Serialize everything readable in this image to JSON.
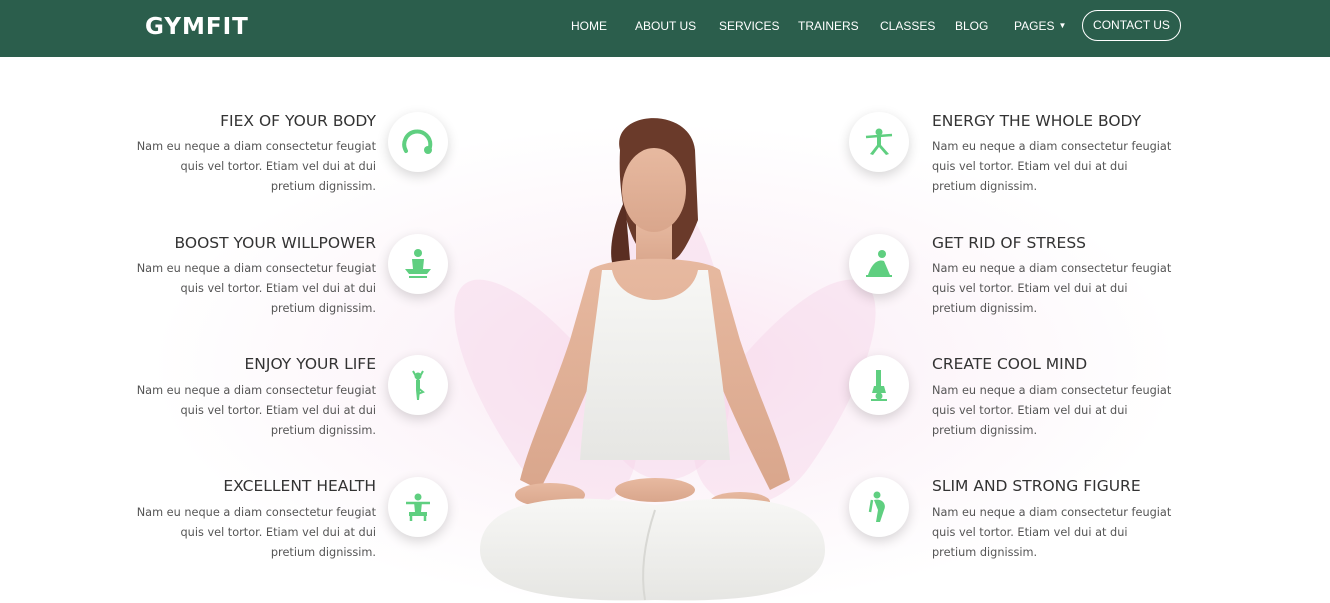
{
  "brand": {
    "logo": "GYMFIT"
  },
  "nav": {
    "items": [
      {
        "label": "HOME"
      },
      {
        "label": "ABOUT US"
      },
      {
        "label": "SERVICES"
      },
      {
        "label": "TRAINERS"
      },
      {
        "label": "CLASSES"
      },
      {
        "label": "BLOG"
      },
      {
        "label": "PAGES"
      }
    ],
    "contact_label": "CONTACT US"
  },
  "colors": {
    "nav_bg": "#2b5e4c",
    "accent_green": "#5fcf80",
    "text_dark": "#333333"
  },
  "features": {
    "left": [
      {
        "title": "FIEX OF YOUR BODY",
        "text": "Nam eu neque a diam consectetur feugiat quis vel tortor. Etiam vel dui at dui pretium dignissim.",
        "icon": "flexibility-gauge-icon"
      },
      {
        "title": "BOOST YOUR WILLPOWER",
        "text": "Nam eu neque a diam consectetur feugiat quis vel tortor. Etiam vel dui at dui pretium dignissim.",
        "icon": "meditation-pose-icon"
      },
      {
        "title": "ENJOY YOUR LIFE",
        "text": "Nam eu neque a diam consectetur feugiat quis vel tortor. Etiam vel dui at dui pretium dignissim.",
        "icon": "tree-pose-icon"
      },
      {
        "title": "EXCELLENT HEALTH",
        "text": "Nam eu neque a diam consectetur feugiat quis vel tortor. Etiam vel dui at dui pretium dignissim.",
        "icon": "seated-stretch-icon"
      }
    ],
    "right": [
      {
        "title": "ENERGY THE WHOLE BODY",
        "text": "Nam eu neque a diam consectetur feugiat quis vel tortor. Etiam vel dui at dui pretium dignissim.",
        "icon": "warrior-pose-icon"
      },
      {
        "title": "GET RID OF STRESS",
        "text": "Nam eu neque a diam consectetur feugiat quis vel tortor. Etiam vel dui at dui pretium dignissim.",
        "icon": "bridge-pose-icon"
      },
      {
        "title": "CREATE COOL MIND",
        "text": "Nam eu neque a diam consectetur feugiat quis vel tortor. Etiam vel dui at dui pretium dignissim.",
        "icon": "headstand-pose-icon"
      },
      {
        "title": "SLIM AND STRONG FIGURE",
        "text": "Nam eu neque a diam consectetur feugiat quis vel tortor. Etiam vel dui at dui pretium dignissim.",
        "icon": "balance-pose-icon"
      }
    ]
  }
}
